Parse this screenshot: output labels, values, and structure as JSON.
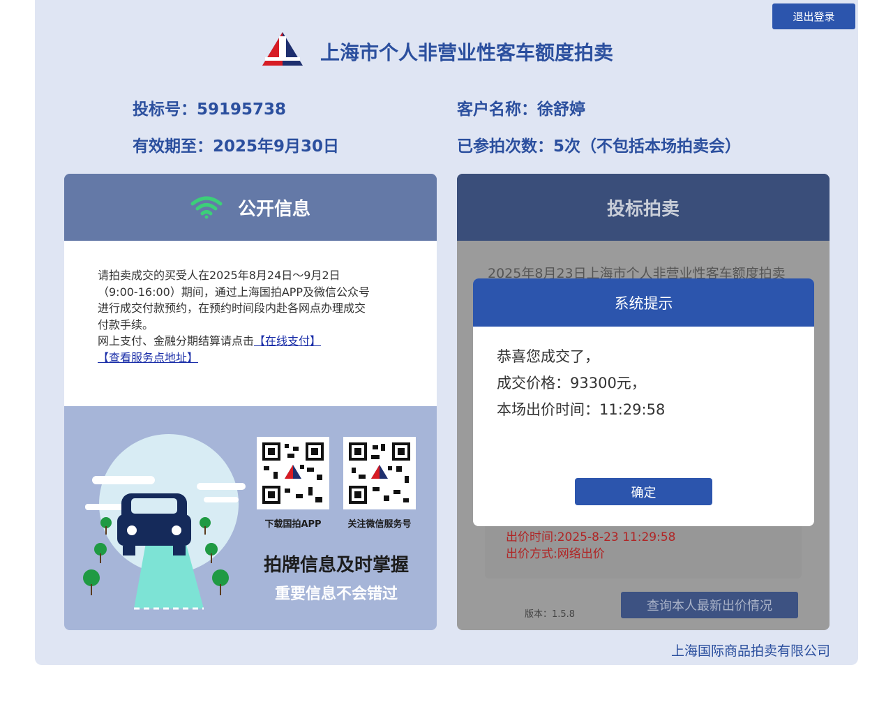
{
  "header": {
    "logout_label": "退出登录",
    "site_title": "上海市个人非营业性客车额度拍卖"
  },
  "account": {
    "bid_number": "投标号：59195738",
    "valid_until": "有效期至：2025年9月30日",
    "customer_name": "客户名称：徐舒婷",
    "attempts": "已参拍次数：5次（不包括本场拍卖会）"
  },
  "public_info": {
    "title": "公开信息",
    "notice_lines": [
      "请拍卖成交的买受人在2025年8月24日～9月2日",
      "（9:00-16:00）期间，通过上海国拍APP及微信公众号",
      "进行成交付款预约，在预约时间段内赴各网点办理成交",
      "付款手续。"
    ],
    "payment_prefix": "网上支付、金融分期结算请点击",
    "online_pay_link": "【在线支付】",
    "service_link": "【查看服务点地址】",
    "qr_app_label": "下载国拍APP",
    "qr_wechat_label": "关注微信服务号",
    "slogan_main": "拍牌信息及时掌握",
    "slogan_sub": "重要信息不会错过"
  },
  "bidding": {
    "title": "投标拍卖",
    "auction_title": "2025年8月23日上海市个人非营业性客车额度拍卖",
    "bid_time": "出价时间:2025-8-23 11:29:58",
    "bid_method": "出价方式:网络出价",
    "version": "版本：1.5.8",
    "query_label": "查询本人最新出价情况"
  },
  "modal": {
    "title": "系统提示",
    "line1": "恭喜您成交了，",
    "line2": "成交价格：93300元，",
    "line3": "本场出价时间：11:29:58",
    "confirm_label": "确定"
  },
  "footer": {
    "company": "上海国际商品拍卖有限公司"
  },
  "colors": {
    "brand_blue": "#2c55ad",
    "title_blue": "#2b4f9e",
    "page_bg": "#dfe5f3",
    "wifi_green": "#3ccf79",
    "bid_red": "#b02525"
  },
  "icons": {
    "logo": "auction-logo-icon",
    "signal": "wifi-icon"
  }
}
